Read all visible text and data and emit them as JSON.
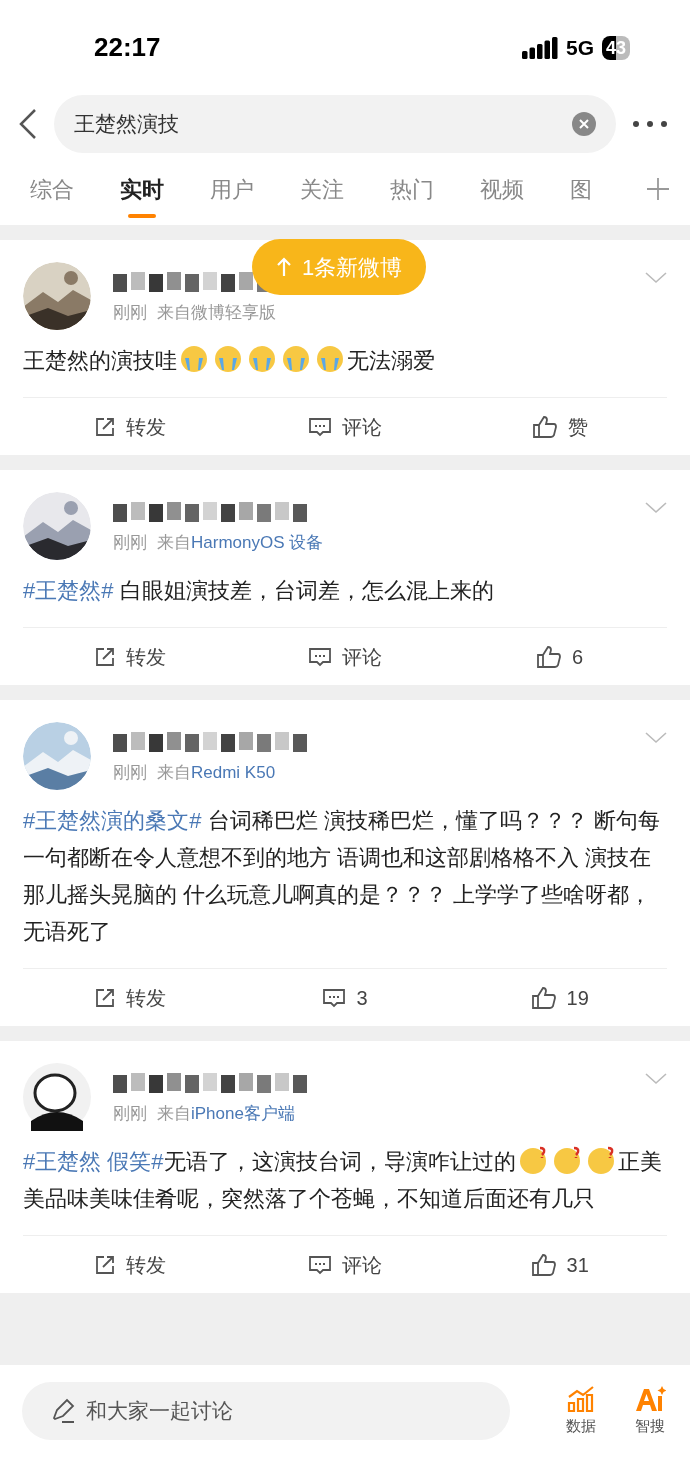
{
  "status_bar": {
    "time": "22:17",
    "network": "5G",
    "battery": "43"
  },
  "search": {
    "value": "王楚然演技"
  },
  "tabs": [
    {
      "label": "综合",
      "selected": false
    },
    {
      "label": "实时",
      "selected": true
    },
    {
      "label": "用户",
      "selected": false
    },
    {
      "label": "关注",
      "selected": false
    },
    {
      "label": "热门",
      "selected": false
    },
    {
      "label": "视频",
      "selected": false
    },
    {
      "label": "图",
      "selected": false
    }
  ],
  "new_posts_toast": {
    "label": "1条新微博"
  },
  "posts": [
    {
      "time": "刚刚",
      "source": {
        "prefix": "来自",
        "name": "微博轻享版",
        "link": false
      },
      "content": [
        {
          "kind": "text",
          "text": "王楚然的演技哇"
        },
        {
          "kind": "emoji"
        },
        {
          "kind": "emoji"
        },
        {
          "kind": "emoji"
        },
        {
          "kind": "emoji"
        },
        {
          "kind": "emoji"
        },
        {
          "kind": "text",
          "text": "无法溺爱"
        }
      ],
      "repost": "转发",
      "comment": "评论",
      "like": "赞"
    },
    {
      "time": "刚刚",
      "source": {
        "prefix": "来自",
        "name": "HarmonyOS 设备",
        "link": true
      },
      "content": [
        {
          "kind": "hashtag",
          "text": "#王楚然#"
        },
        {
          "kind": "text",
          "text": " 白眼姐演技差，台词差，怎么混上来的"
        }
      ],
      "repost": "转发",
      "comment": "评论",
      "like": "6"
    },
    {
      "time": "刚刚",
      "source": {
        "prefix": "来自",
        "name": "Redmi K50",
        "link": true
      },
      "content": [
        {
          "kind": "hashtag",
          "text": "#王楚然演的桑文#"
        },
        {
          "kind": "text",
          "text": " 台词稀巴烂 演技稀巴烂，懂了吗？？？  断句每一句都断在令人意想不到的地方 语调也和这部剧格格不入 演技在那儿摇头晃脑的 什么玩意儿啊真的是？？？  上学学了些啥呀都，无语死了"
        }
      ],
      "repost": "转发",
      "comment": "3",
      "like": "19"
    },
    {
      "avatar": {
        "kind": "figure"
      },
      "time": "刚刚",
      "source": {
        "prefix": "来自",
        "name": "iPhone客户端",
        "link": true
      },
      "content": [
        {
          "kind": "hashtag",
          "text": "#王楚然 假笑#"
        },
        {
          "kind": "text",
          "text": "无语了，这演技台词，导演咋让过的"
        },
        {
          "kind": "emoji2"
        },
        {
          "kind": "emoji2"
        },
        {
          "kind": "emoji2"
        },
        {
          "kind": "text",
          "text": "正美美品味美味佳肴呢，突然落了个苍蝇，不知道后面还有几只"
        }
      ],
      "repost": "转发",
      "comment": "评论",
      "like": "31"
    }
  ],
  "bottom_bar": {
    "placeholder": "和大家一起讨论",
    "buttons": [
      {
        "label": "数据"
      },
      {
        "label": "智搜"
      }
    ]
  }
}
